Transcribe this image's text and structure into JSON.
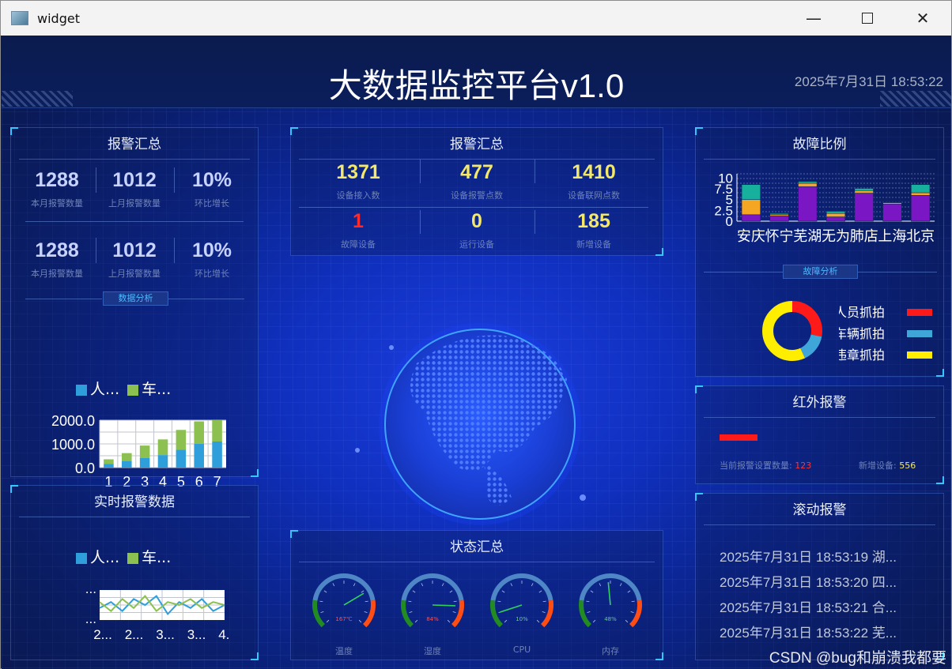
{
  "window": {
    "title": "widget",
    "min_icon": "minimize-icon",
    "max_icon": "maximize-icon",
    "close_icon": "close-icon"
  },
  "header": {
    "title": "大数据监控平台v1.0",
    "datetime": "2025年7月31日 18:53:22"
  },
  "left_top": {
    "title": "报警汇总",
    "row1": [
      {
        "value": "1288",
        "label": "本月报警数量"
      },
      {
        "value": "1012",
        "label": "上月报警数量"
      },
      {
        "value": "10%",
        "label": "环比增长"
      }
    ],
    "row2": [
      {
        "value": "1288",
        "label": "本月报警数量"
      },
      {
        "value": "1012",
        "label": "上月报警数量"
      },
      {
        "value": "10%",
        "label": "环比增长"
      }
    ],
    "tag": "数据分析",
    "legend": [
      "人...",
      "车..."
    ]
  },
  "left_bottom": {
    "title": "实时报警数据",
    "legend": [
      "人...",
      "车..."
    ]
  },
  "center_top": {
    "title": "报警汇总",
    "row1": [
      {
        "value": "1371",
        "label": "设备接入数"
      },
      {
        "value": "477",
        "label": "设备报警点数"
      },
      {
        "value": "1410",
        "label": "设备联网点数"
      }
    ],
    "row2": [
      {
        "value": "1",
        "label": "故障设备"
      },
      {
        "value": "0",
        "label": "运行设备"
      },
      {
        "value": "185",
        "label": "新增设备"
      }
    ]
  },
  "center_bottom": {
    "title": "状态汇总",
    "gauges": [
      {
        "label": "温度",
        "readout": "167℃",
        "value": 0.72
      },
      {
        "label": "湿度",
        "readout": "84%",
        "value": 0.84
      },
      {
        "label": "CPU",
        "readout": "10%",
        "value": 0.1
      },
      {
        "label": "内存",
        "readout": "48%",
        "value": 0.48
      }
    ]
  },
  "right_top": {
    "title": "故障比例",
    "tag": "故障分析",
    "donut_legend": [
      "人员抓拍",
      "车辆抓拍",
      "违章抓拍"
    ]
  },
  "right_mid": {
    "title": "红外报警",
    "count_label": "当前报警设置数量:",
    "count_value": "123",
    "new_label": "新增设备:",
    "new_value": "556"
  },
  "right_bottom": {
    "title": "滚动报警",
    "lines": [
      "2025年7月31日 18:53:19  湖...",
      "2025年7月31日 18:53:20  四...",
      "2025年7月31日 18:53:21  合...",
      "2025年7月31日 18:53:22  芜..."
    ]
  },
  "watermark": "CSDN @bug和崩溃我都要",
  "colors": {
    "yellow": "#f3e86a",
    "red": "#ff2a2a",
    "blue_num": "#c8d2ff",
    "accent": "#34c6ff"
  },
  "chart_data": [
    {
      "type": "bar",
      "stacked": true,
      "categories": [
        "1",
        "2",
        "3",
        "4",
        "5",
        "6",
        "7"
      ],
      "series": [
        {
          "name": "人...",
          "values": [
            150,
            280,
            400,
            530,
            760,
            1000,
            1100
          ]
        },
        {
          "name": "车...",
          "values": [
            200,
            330,
            530,
            660,
            830,
            950,
            900
          ]
        }
      ],
      "ylim": [
        0,
        2000
      ],
      "yticks": [
        "0.0",
        "1000.0",
        "2000.0"
      ]
    },
    {
      "type": "line",
      "series": [
        {
          "name": "人...",
          "values": [
            4,
            6,
            3,
            7,
            5,
            8,
            2,
            6,
            4,
            7,
            3,
            5
          ]
        },
        {
          "name": "车...",
          "values": [
            6,
            3,
            7,
            4,
            8,
            3,
            6,
            5,
            7,
            4,
            6,
            5
          ]
        }
      ],
      "xticks": [
        "2...",
        "2...",
        "3...",
        "3...",
        "4..."
      ],
      "yticks": [
        "...",
        "..."
      ]
    },
    {
      "type": "bar",
      "stacked": true,
      "categories": [
        "安庆",
        "怀宁",
        "芜湖",
        "无为",
        "肺店",
        "上海",
        "北京"
      ],
      "series": [
        {
          "values": [
            1.5,
            1.2,
            8,
            1,
            6.5,
            4,
            6
          ]
        },
        {
          "values": [
            3.5,
            0.3,
            0.8,
            0.8,
            0.6,
            0.3,
            0.6
          ]
        },
        {
          "values": [
            3.5,
            0.3,
            0.4,
            0.5,
            0.5,
            0.1,
            1.9
          ]
        }
      ],
      "ylim": [
        0,
        11
      ],
      "yticks": [
        "0",
        "2.5",
        "5",
        "7.5",
        "10"
      ],
      "colors": [
        "#7b16c4",
        "#f5a623",
        "#16b09c"
      ]
    },
    {
      "type": "pie",
      "donut": true,
      "values": [
        0.28,
        0.15,
        0.57
      ],
      "names": [
        "人员抓拍",
        "车辆抓拍",
        "违章抓拍"
      ],
      "colors": [
        "#ff1a1a",
        "#3ea6d9",
        "#ffee00"
      ]
    }
  ]
}
